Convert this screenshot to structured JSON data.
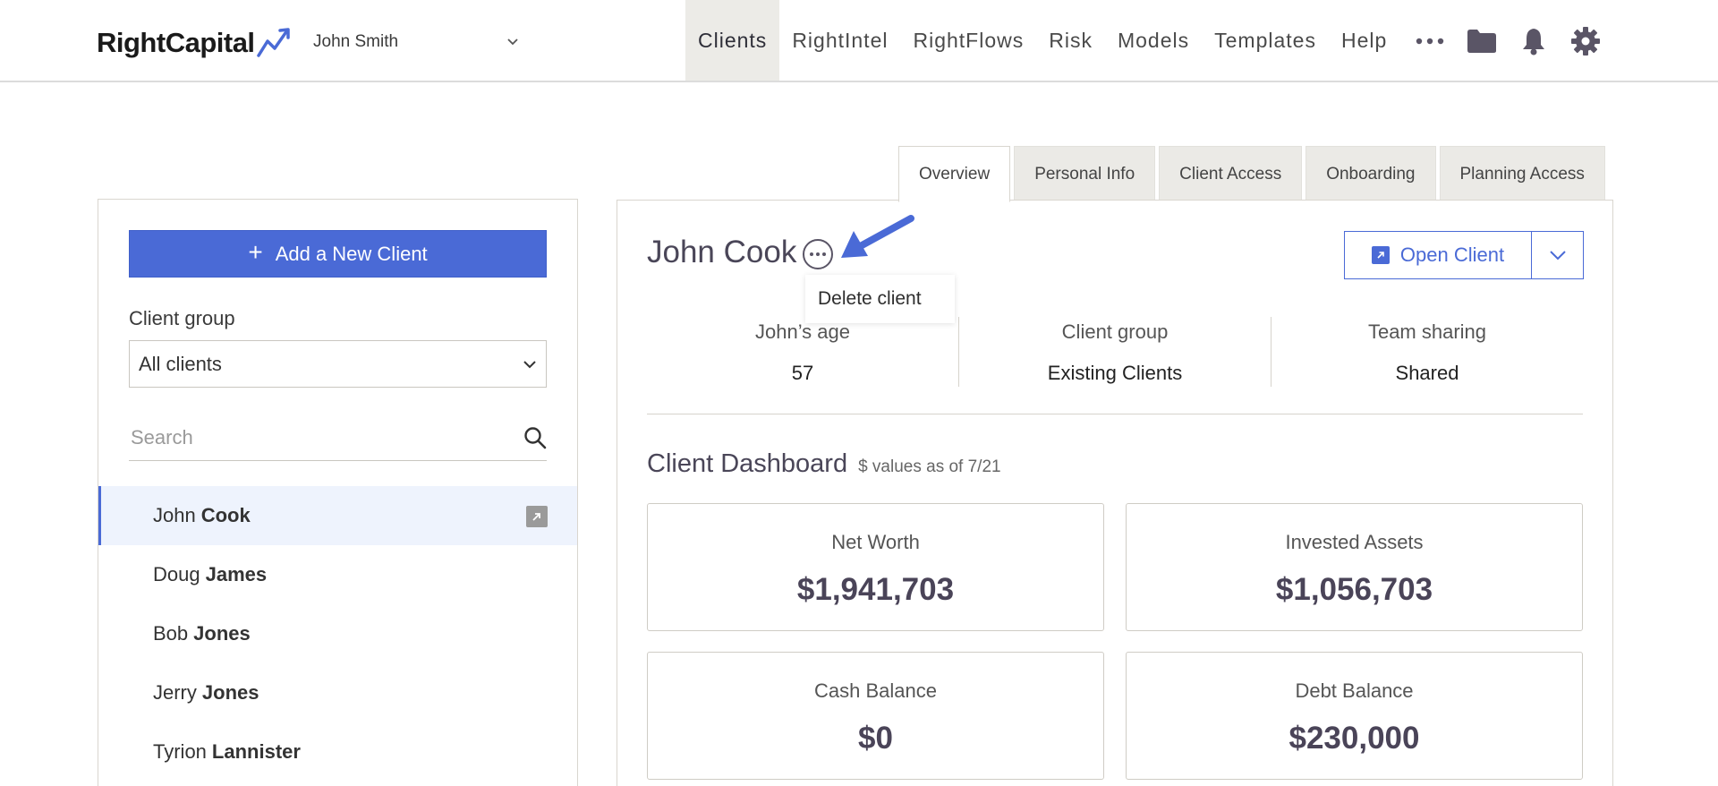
{
  "brand": {
    "name": "RightCapital",
    "accent": "#4a6ad6"
  },
  "user_select": {
    "value": "John Smith"
  },
  "nav": {
    "items": [
      {
        "label": "Clients",
        "active": true
      },
      {
        "label": "RightIntel",
        "active": false
      },
      {
        "label": "RightFlows",
        "active": false
      },
      {
        "label": "Risk",
        "active": false
      },
      {
        "label": "Models",
        "active": false
      },
      {
        "label": "Templates",
        "active": false
      },
      {
        "label": "Help",
        "active": false
      }
    ],
    "icons": [
      "more-icon",
      "folder-icon",
      "bell-icon",
      "gear-icon"
    ]
  },
  "tabs": [
    {
      "label": "Overview",
      "active": true
    },
    {
      "label": "Personal Info",
      "active": false
    },
    {
      "label": "Client Access",
      "active": false
    },
    {
      "label": "Onboarding",
      "active": false
    },
    {
      "label": "Planning Access",
      "active": false
    }
  ],
  "sidebar": {
    "add_button": "Add a New Client",
    "client_group_label": "Client group",
    "client_group_value": "All clients",
    "search_placeholder": "Search",
    "clients": [
      {
        "first": "John",
        "last": "Cook",
        "selected": true
      },
      {
        "first": "Doug",
        "last": "James",
        "selected": false
      },
      {
        "first": "Bob",
        "last": "Jones",
        "selected": false
      },
      {
        "first": "Jerry",
        "last": "Jones",
        "selected": false
      },
      {
        "first": "Tyrion",
        "last": "Lannister",
        "selected": false
      }
    ]
  },
  "detail": {
    "client_name": "John Cook",
    "popup_item": "Delete client",
    "open_button": "Open Client",
    "stats": [
      {
        "label": "John’s age",
        "value": "57"
      },
      {
        "label": "Client group",
        "value": "Existing Clients"
      },
      {
        "label": "Team sharing",
        "value": "Shared"
      }
    ],
    "dashboard_title": "Client Dashboard",
    "dashboard_subtitle": "$ values as of 7/21",
    "cards": [
      {
        "label": "Net Worth",
        "value": "$1,941,703"
      },
      {
        "label": "Invested Assets",
        "value": "$1,056,703"
      },
      {
        "label": "Cash Balance",
        "value": "$0"
      },
      {
        "label": "Debt Balance",
        "value": "$230,000"
      }
    ]
  }
}
